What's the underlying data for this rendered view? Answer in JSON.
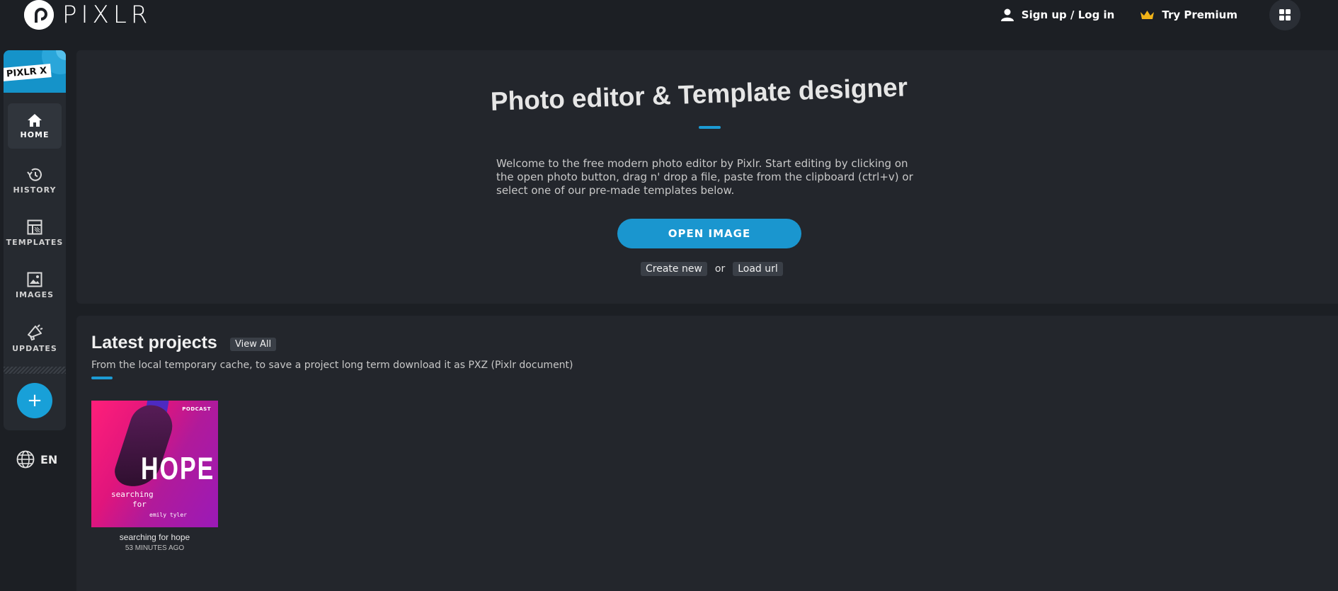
{
  "brand": {
    "logo_text": "PIXLR",
    "badge": "PIXLR X"
  },
  "header": {
    "signup": "Sign up / Log in",
    "premium": "Try Premium"
  },
  "sidebar": {
    "items": [
      {
        "label": "HOME",
        "icon": "home-icon"
      },
      {
        "label": "HISTORY",
        "icon": "history-icon"
      },
      {
        "label": "TEMPLATES",
        "icon": "templates-icon"
      },
      {
        "label": "IMAGES",
        "icon": "images-icon"
      },
      {
        "label": "UPDATES",
        "icon": "updates-icon"
      }
    ],
    "add_label": "+",
    "language": "EN"
  },
  "hero": {
    "title": "Photo editor & Template designer",
    "description": "Welcome to the free modern photo editor by Pixlr. Start editing by clicking on the open photo button, drag n' drop a file, paste from the clipboard (ctrl+v) or select one of our pre-made templates below.",
    "open_button": "OPEN IMAGE",
    "create_new": "Create new",
    "or": "or",
    "load_url": "Load url"
  },
  "projects": {
    "title": "Latest projects",
    "view_all": "View All",
    "subtitle": "From the local temporary cache, to save a project long term download it as PXZ (Pixlr document)",
    "items": [
      {
        "name": "searching for hope",
        "time": "53 MINUTES AGO",
        "thumb_podcast": "PODCAST",
        "thumb_title": "HOPE",
        "thumb_line1": "searching",
        "thumb_line2": "for",
        "thumb_author": "emily tyler"
      }
    ]
  },
  "colors": {
    "accent": "#1a96cf",
    "background": "#1c1f24",
    "panel": "#23262c"
  }
}
